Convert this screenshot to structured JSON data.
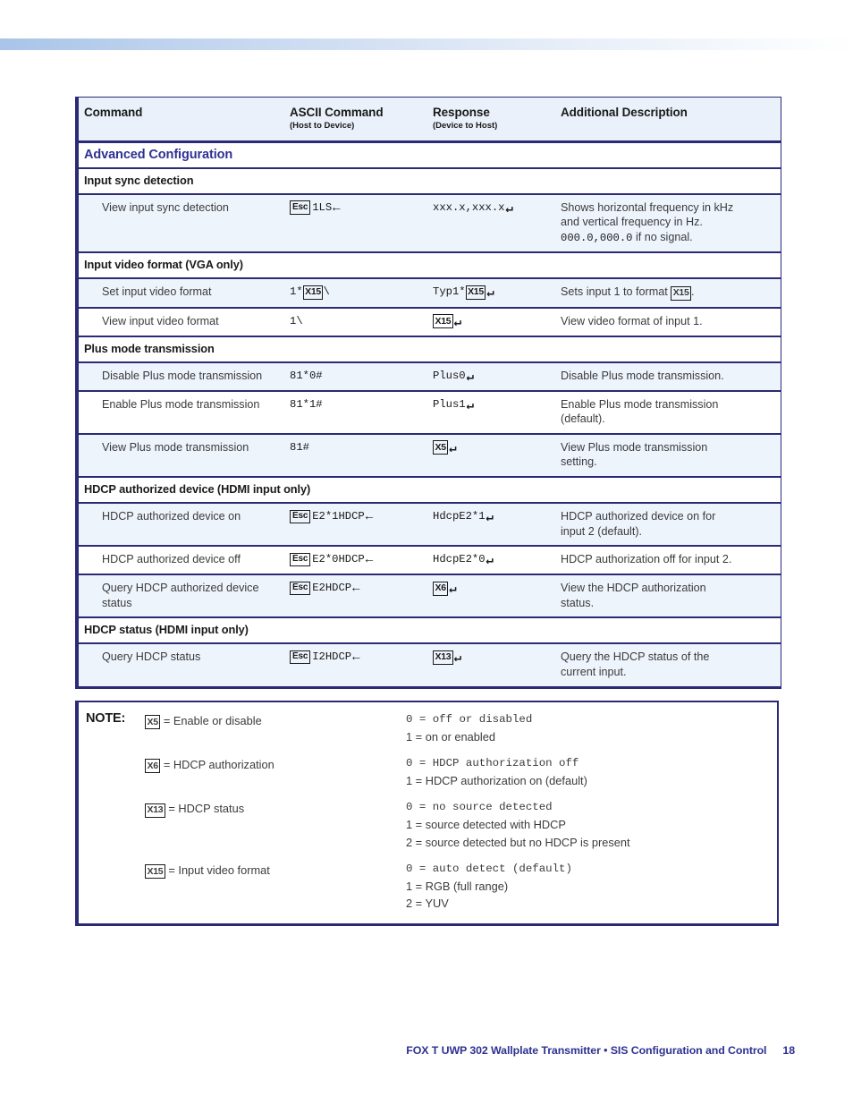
{
  "table": {
    "headers": {
      "command": "Command",
      "ascii_main": "ASCII Command",
      "ascii_sub": "(Host to Device)",
      "response_main": "Response",
      "response_sub": "(Device to Host)",
      "description": "Additional Description"
    },
    "section_title": "Advanced Configuration",
    "sections": [
      {
        "heading": "Input sync detection",
        "rows": [
          {
            "command": "View input sync detection",
            "ascii_prefix_esc": "Esc",
            "ascii_text": "1LS",
            "ascii_arrow": "←",
            "response_text": "xxx.x,xxx.x",
            "response_arrow": "↵",
            "description_line1": "Shows horizontal frequency in kHz",
            "description_line2": "and vertical frequency in Hz.",
            "description_mono": "000.0,000.0",
            "description_line3_tail": " if no signal."
          }
        ]
      },
      {
        "heading": "Input video format (VGA only)",
        "rows": [
          {
            "command": "Set input video format",
            "ascii_text_a": "1*",
            "ascii_var": "X15",
            "ascii_text_b": "\\",
            "response_text_a": "Typ1*",
            "response_var": "X15",
            "response_arrow": "↵",
            "description_a": "Sets input 1 to format ",
            "description_var": "X15",
            "description_b": "."
          },
          {
            "command": "View input video format",
            "ascii_text": "1\\",
            "response_var": "X15",
            "response_arrow": "↵",
            "description": "View video format of input 1."
          }
        ]
      },
      {
        "heading": "Plus mode transmission",
        "rows": [
          {
            "command": "Disable Plus mode transmission",
            "ascii_text": "81*0#",
            "response_text": "Plus0",
            "response_arrow": "↵",
            "description": "Disable Plus mode transmission."
          },
          {
            "command": "Enable Plus mode transmission",
            "ascii_text": "81*1#",
            "response_text": "Plus1",
            "response_arrow": "↵",
            "description_line1": "Enable Plus mode transmission",
            "description_line2": "(default)."
          },
          {
            "command": "View Plus mode transmission",
            "ascii_text": "81#",
            "response_var": "X5",
            "response_arrow": "↵",
            "description_line1": "View Plus mode transmission",
            "description_line2": "setting."
          }
        ]
      },
      {
        "heading": "HDCP authorized device (HDMI input only)",
        "rows": [
          {
            "command": "HDCP authorized device on",
            "ascii_prefix_esc": "Esc",
            "ascii_text": "E2*1HDCP",
            "ascii_arrow": "←",
            "response_text": "HdcpE2*1",
            "response_arrow": "↵",
            "description_line1": "HDCP authorized device on for",
            "description_line2": "input 2 (default)."
          },
          {
            "command": "HDCP authorized device off",
            "ascii_prefix_esc": "Esc",
            "ascii_text": "E2*0HDCP",
            "ascii_arrow": "←",
            "response_text": "HdcpE2*0",
            "response_arrow": "↵",
            "description": "HDCP authorization off for input 2."
          },
          {
            "command": "Query HDCP authorized device status",
            "ascii_prefix_esc": "Esc",
            "ascii_text": "E2HDCP",
            "ascii_arrow": "←",
            "response_var": "X6",
            "response_arrow": "↵",
            "description_line1": "View the HDCP authorization",
            "description_line2": "status."
          }
        ]
      },
      {
        "heading": "HDCP status (HDMI input only)",
        "rows": [
          {
            "command": "Query HDCP status",
            "ascii_prefix_esc": "Esc",
            "ascii_text": "I2HDCP",
            "ascii_arrow": "←",
            "response_var": "X13",
            "response_arrow": "↵",
            "description_line1": "Query the HDCP status of the",
            "description_line2": "current input."
          }
        ]
      }
    ]
  },
  "note": {
    "title": "NOTE:",
    "groups": [
      {
        "var": "X5",
        "label": "= Enable or disable",
        "values": [
          "0 = off or disabled",
          "1 = on or enabled"
        ]
      },
      {
        "var": "X6",
        "label": "= HDCP authorization",
        "values": [
          "0 = HDCP authorization off",
          "1 = HDCP authorization on (default)"
        ]
      },
      {
        "var": "X13",
        "label": "= HDCP status",
        "values": [
          "0 = no source detected",
          "1 = source detected with HDCP",
          "2 = source detected but no HDCP is present"
        ]
      },
      {
        "var": "X15",
        "label": "= Input video format",
        "values": [
          "0 = auto detect (default)",
          "1 = RGB (full range)",
          "2 = YUV"
        ]
      }
    ]
  },
  "footer": {
    "text": "FOX T UWP 302 Wallplate Transmitter • SIS Configuration and Control",
    "page": "18"
  },
  "colors": {
    "accent_blue": "#2f3192",
    "border_navy": "#2b2a76",
    "row_tint": "#eef4fc",
    "header_fill": "#eaf1fb"
  }
}
